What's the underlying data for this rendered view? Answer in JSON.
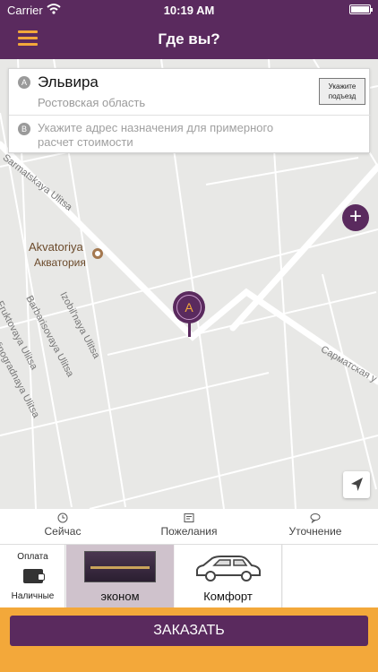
{
  "status_bar": {
    "carrier": "Carrier",
    "time": "10:19 AM"
  },
  "nav": {
    "title": "Где вы?",
    "menu_icon": "hamburger-icon"
  },
  "address": {
    "pickup_letter": "A",
    "pickup_name": "Эльвира",
    "pickup_region": "Ростовская область",
    "entrance_button": "Укажите подъезд",
    "destination_letter": "B",
    "destination_placeholder": "Укажите адрес назначения для примерного расчет стоимости"
  },
  "map": {
    "poi_name": "Akvatoriya",
    "poi_name_ru": "Акватория",
    "marker_letter": "A",
    "street_labels": [
      "Sarmatskaya Ulitsa",
      "Izobil'naya Ulitsa",
      "Barbarisovaya Ulitsa",
      "Fruktovaya Ulitsa",
      "Vinogradnaya Ulitsa",
      "Сарматская у"
    ],
    "zoom_in_label": "+"
  },
  "tabs": [
    {
      "label": "Сейчас",
      "icon": "clock-icon"
    },
    {
      "label": "Пожелания",
      "icon": "note-icon"
    },
    {
      "label": "Уточнение",
      "icon": "chat-icon"
    }
  ],
  "payment": {
    "label": "Оплата",
    "value": "Наличные",
    "icon": "wallet-icon"
  },
  "tariffs": [
    {
      "name": "эконом",
      "selected": true
    },
    {
      "name": "Комфорт",
      "selected": false
    }
  ],
  "order_button": "ЗАКАЗАТЬ",
  "colors": {
    "brand_purple": "#5a2a5e",
    "accent_orange": "#f3a83a"
  }
}
